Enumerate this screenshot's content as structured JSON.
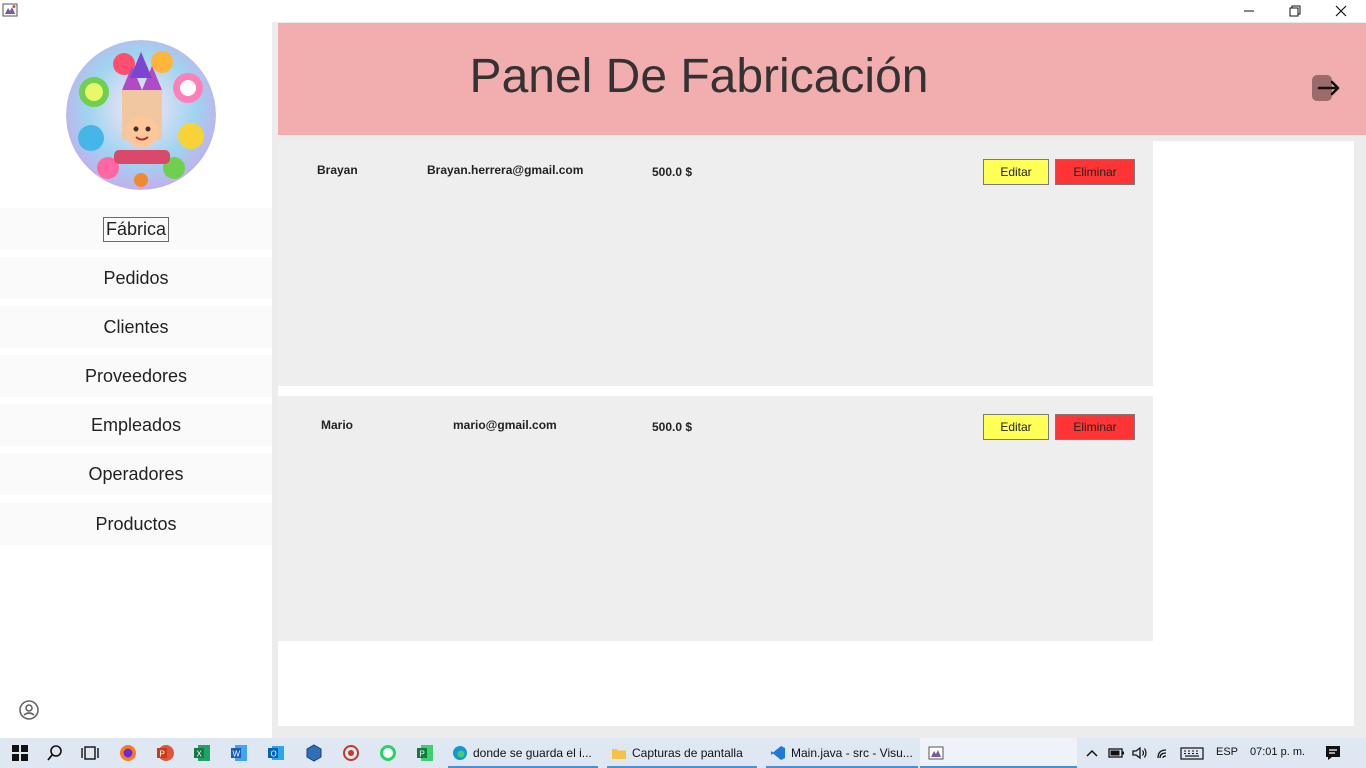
{
  "window": {
    "minimize_icon": "minimize-icon",
    "maximize_icon": "restore-icon",
    "close_icon": "close-icon"
  },
  "sidebar": {
    "items": [
      {
        "label": "Fábrica",
        "active": true
      },
      {
        "label": "Pedidos"
      },
      {
        "label": "Clientes"
      },
      {
        "label": "Proveedores"
      },
      {
        "label": "Empleados"
      },
      {
        "label": "Operadores"
      },
      {
        "label": "Productos"
      }
    ]
  },
  "header": {
    "title": "Panel De Fabricación",
    "logout_icon": "logout-arrow-icon"
  },
  "records": [
    {
      "name": "Brayan",
      "email": "Brayan.herrera@gmail.com",
      "amount": "500.0 $",
      "edit_label": "Editar",
      "delete_label": "Eliminar"
    },
    {
      "name": "Mario",
      "email": "mario@gmail.com",
      "amount": "500.0 $",
      "edit_label": "Editar",
      "delete_label": "Eliminar"
    }
  ],
  "taskbar": {
    "apps": [
      {
        "label": "donde se guarda el i..."
      },
      {
        "label": "Capturas de pantalla"
      },
      {
        "label": "Main.java - src - Visu..."
      }
    ],
    "language": "ESP",
    "clock": "07:01 p. m."
  },
  "colors": {
    "header_bg": "#f2aeae",
    "edit_button": "#ffff55",
    "delete_button": "#ff3535",
    "card_bg": "#eeeeee"
  }
}
